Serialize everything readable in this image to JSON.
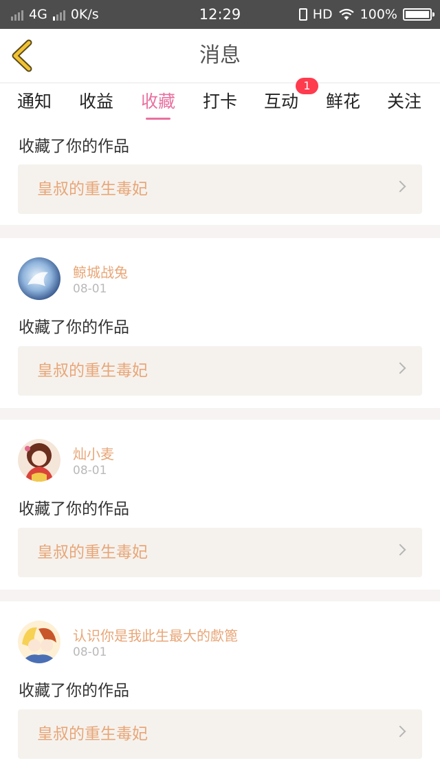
{
  "status_bar": {
    "network": "4G",
    "speed": "0K/s",
    "time": "12:29",
    "hd": "HD",
    "battery": "100%"
  },
  "nav": {
    "title": "消息",
    "back_icon": "chevron-left-icon"
  },
  "tabs": [
    {
      "label": "通知"
    },
    {
      "label": "收益"
    },
    {
      "label": "收藏",
      "active": true
    },
    {
      "label": "打卡"
    },
    {
      "label": "互动",
      "badge": "1"
    },
    {
      "label": "鲜花"
    },
    {
      "label": "关注"
    }
  ],
  "colors": {
    "accent": "#e9709f",
    "username": "#e8a677",
    "badge": "#ff3b4e"
  },
  "items": [
    {
      "action": "收藏了你的作品",
      "work_title": "皇叔的重生毒妃"
    },
    {
      "user": "鲸城战兔",
      "date": "08-01",
      "action": "收藏了你的作品",
      "work_title": "皇叔的重生毒妃"
    },
    {
      "user": "灿小麦",
      "date": "08-01",
      "action": "收藏了你的作品",
      "work_title": "皇叔的重生毒妃"
    },
    {
      "user": "认识你是我此生最大的歔篦",
      "date": "08-01",
      "action": "收藏了你的作品",
      "work_title": "皇叔的重生毒妃"
    }
  ]
}
